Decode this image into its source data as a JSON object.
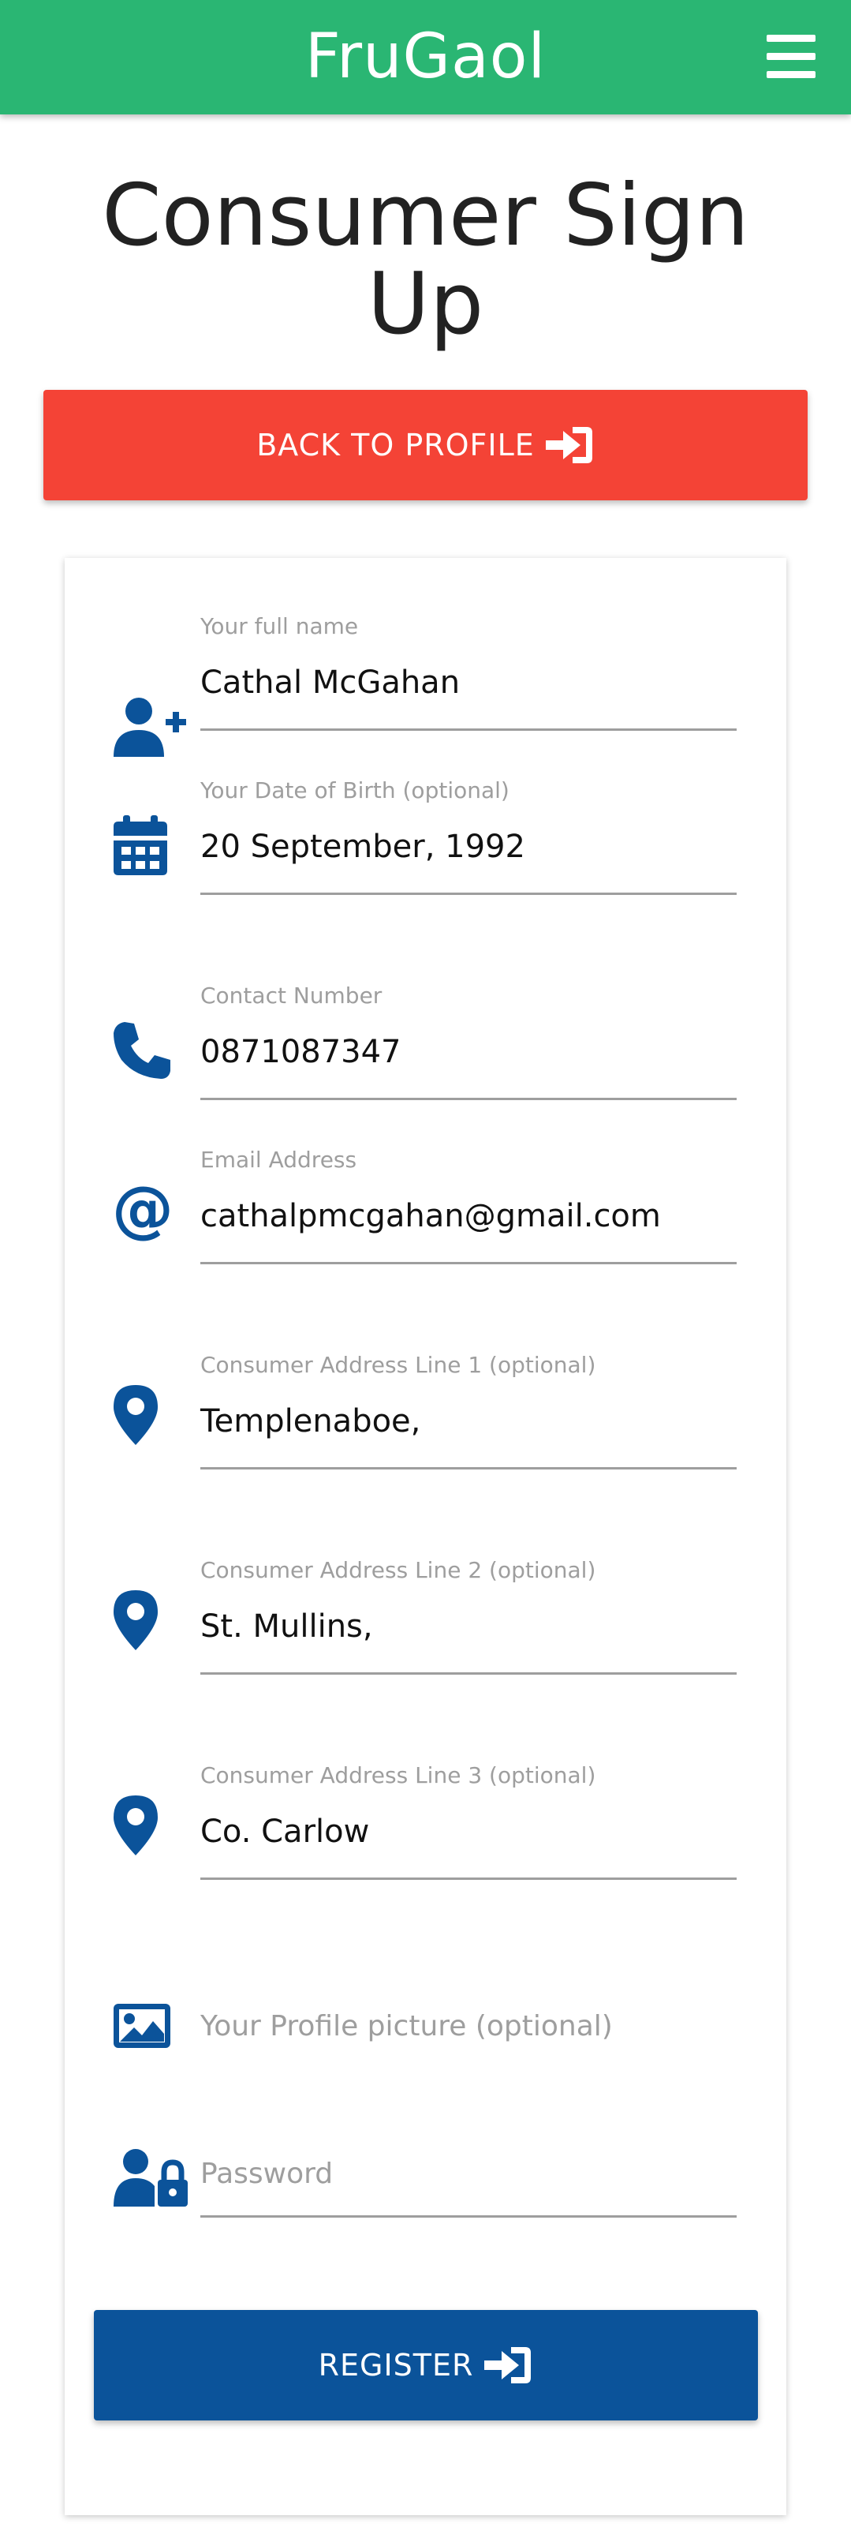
{
  "app": {
    "brand": "FruGaol"
  },
  "page": {
    "title": "Consumer Sign Up"
  },
  "back_button": {
    "label": "BACK TO PROFILE"
  },
  "form": {
    "full_name": {
      "label": "Your full name",
      "value": "Cathal McGahan"
    },
    "dob": {
      "label": "Your Date of Birth (optional)",
      "value": "20 September, 1992"
    },
    "contact": {
      "label": "Contact Number",
      "value": "0871087347"
    },
    "email": {
      "label": "Email Address",
      "value": "cathalpmcgahan@gmail.com"
    },
    "address1": {
      "label": "Consumer Address Line 1 (optional)",
      "value": "Templenaboe,"
    },
    "address2": {
      "label": "Consumer Address Line 2 (optional)",
      "value": "St. Mullins,"
    },
    "address3": {
      "label": "Consumer Address Line 3 (optional)",
      "value": "Co. Carlow"
    },
    "profile_picture": {
      "placeholder": "Your Profile picture (optional)"
    },
    "password": {
      "placeholder": "Password"
    }
  },
  "register_button": {
    "label": "REGISTER"
  },
  "icons": {
    "menu": "hamburger-icon",
    "sign_in": "sign-in-icon",
    "user_plus": "user-plus-icon",
    "calendar": "calendar-icon",
    "phone": "phone-icon",
    "at": "at-sign-icon",
    "pin": "map-pin-icon",
    "image": "image-icon",
    "user_lock": "user-lock-icon"
  },
  "colors": {
    "navbar": "#2ab673",
    "back_button": "#f44336",
    "register_button": "#0b539a",
    "icon": "#0b539a"
  }
}
